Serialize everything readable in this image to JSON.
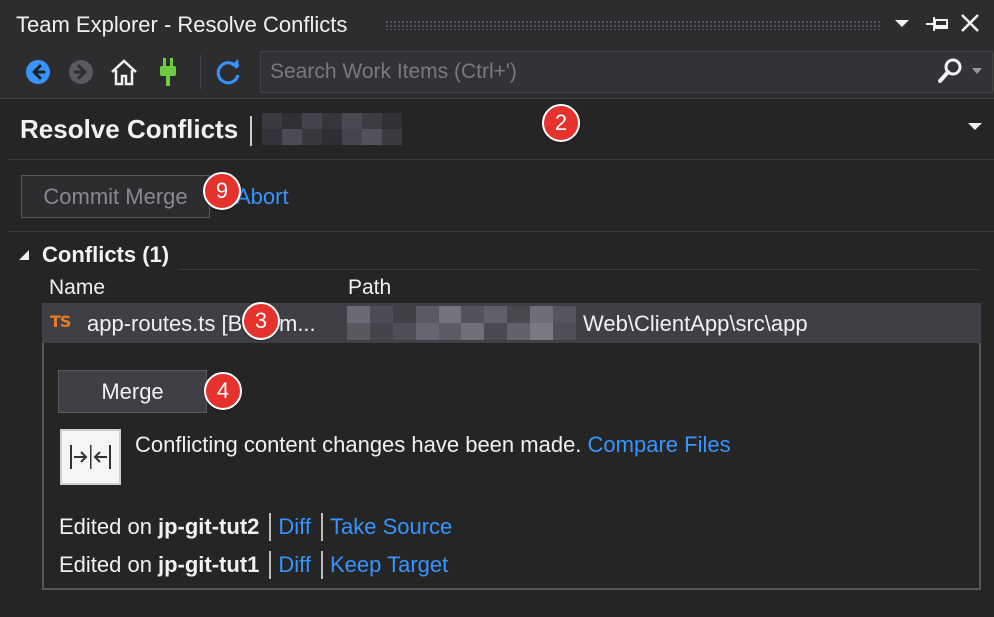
{
  "window": {
    "title": "Team Explorer - Resolve Conflicts"
  },
  "toolbar": {
    "buttons": [
      {
        "name": "back",
        "icon": "back-arrow-icon"
      },
      {
        "name": "forward",
        "icon": "forward-arrow-icon"
      },
      {
        "name": "home",
        "icon": "home-icon"
      },
      {
        "name": "connect",
        "icon": "plug-icon"
      },
      {
        "name": "refresh",
        "icon": "refresh-icon"
      }
    ],
    "search": {
      "placeholder": "Search Work Items (Ctrl+')",
      "value": ""
    }
  },
  "page": {
    "title": "Resolve Conflicts"
  },
  "actions": {
    "commit_merge_label": "Commit Merge",
    "abort_label": "Abort"
  },
  "conflicts": {
    "heading": "Conflicts (1)",
    "columns": {
      "name": "Name",
      "path": "Path"
    },
    "items": [
      {
        "file_type": "TS",
        "name": "app-routes.ts [Both m...",
        "path_visible_suffix": "Web\\ClientApp\\src\\app"
      }
    ]
  },
  "details": {
    "merge_label": "Merge",
    "message": "Conflicting content changes have been made.",
    "compare_link": "Compare Files",
    "edits": [
      {
        "prefix": "Edited on",
        "branch": "jp-git-tut2",
        "diff_link": "Diff",
        "action_link": "Take Source"
      },
      {
        "prefix": "Edited on",
        "branch": "jp-git-tut1",
        "diff_link": "Diff",
        "action_link": "Keep Target"
      }
    ]
  },
  "callouts": [
    "2",
    "9",
    "3",
    "4"
  ],
  "colors": {
    "background": "#252526",
    "chrome": "#2d2d30",
    "link": "#3794ff",
    "selected_row": "#3f3f46",
    "callout": "#e5322d",
    "ts_icon": "#e97a25",
    "back_icon": "#3794ff",
    "connect_icon": "#6ccb3f"
  }
}
